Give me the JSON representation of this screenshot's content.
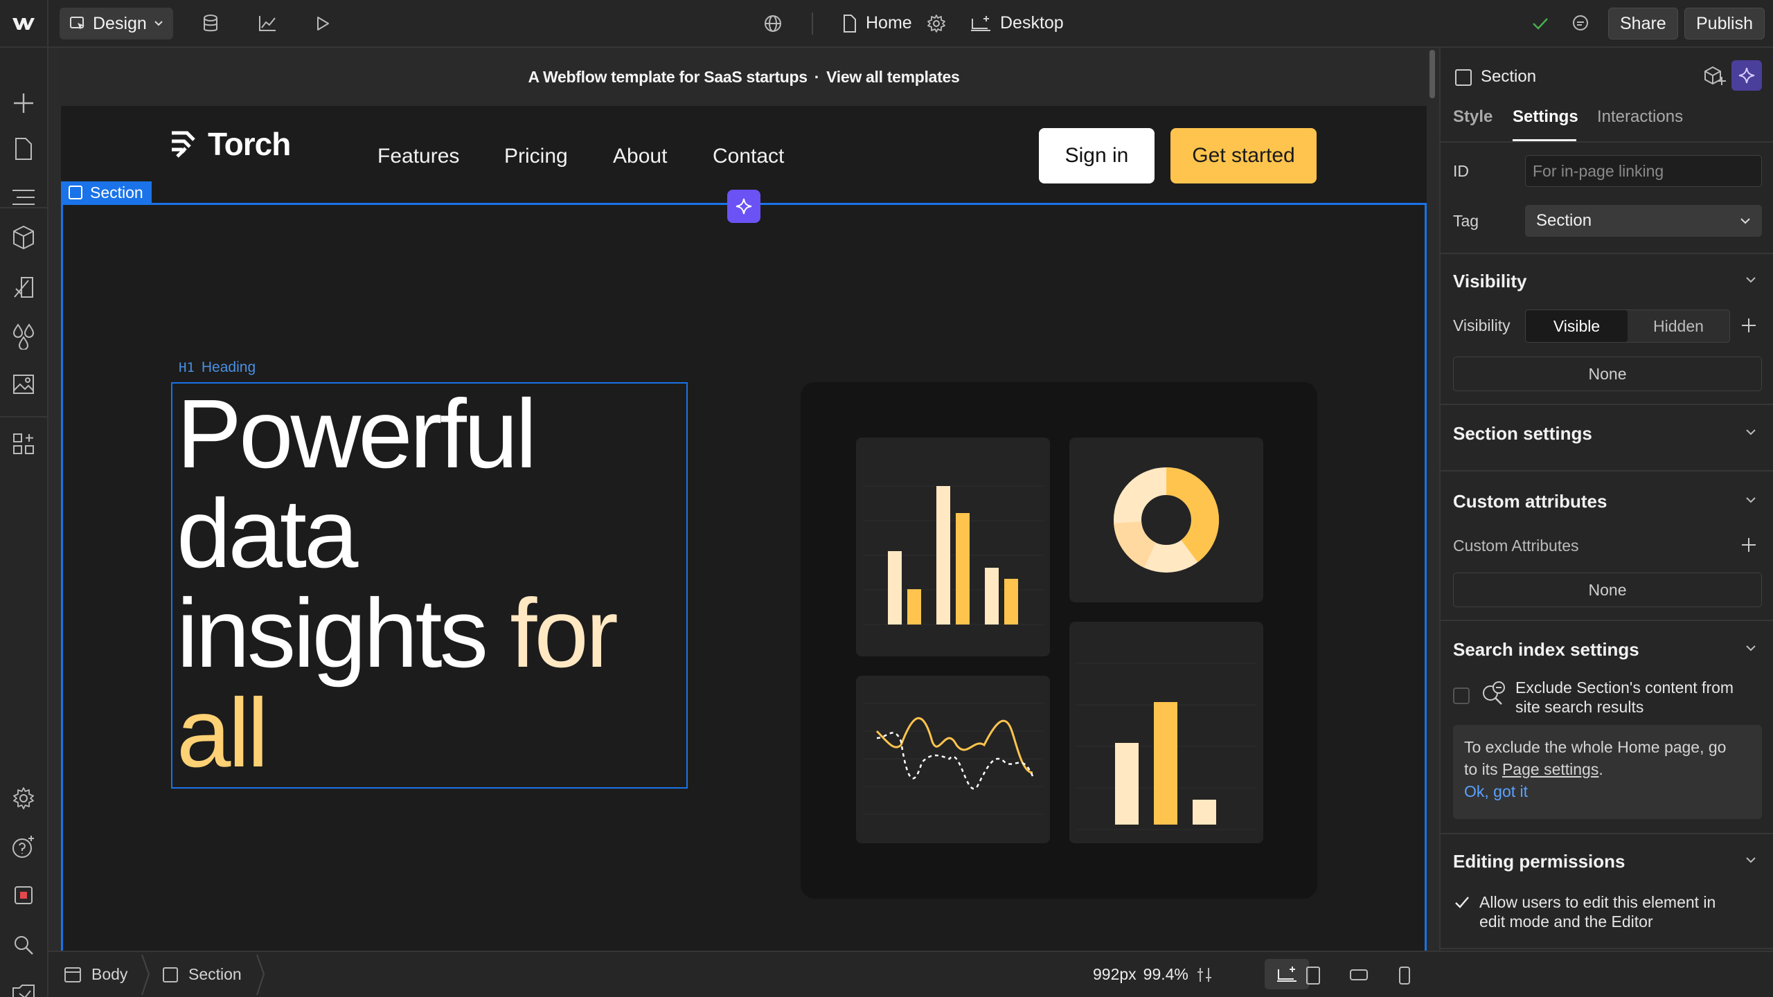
{
  "toolbar": {
    "mode_label": "Design",
    "page_name": "Home",
    "breakpoint_label": "Desktop",
    "share_label": "Share",
    "publish_label": "Publish"
  },
  "canvas": {
    "banner_text": "A Webflow template for SaaS startups",
    "banner_sep": "·",
    "banner_link": "View all templates",
    "brand_name": "Torch",
    "nav_links": [
      "Features",
      "Pricing",
      "About",
      "Contact"
    ],
    "signin_label": "Sign in",
    "cta_label": "Get started",
    "section_tag": "Section",
    "h1_tag_code": "H1",
    "h1_tag_label": "Heading",
    "heading_line1": "Powerful",
    "heading_line2": "data",
    "heading_line3a": "insights",
    "heading_line3b": "for",
    "heading_line4": "all"
  },
  "panel": {
    "element_name": "Section",
    "tabs": [
      "Style",
      "Settings",
      "Interactions"
    ],
    "active_tab": "Settings",
    "id_label": "ID",
    "id_placeholder": "For in-page linking",
    "tag_label": "Tag",
    "tag_value": "Section",
    "visibility_heading": "Visibility",
    "visibility_label": "Visibility",
    "visible_option": "Visible",
    "hidden_option": "Hidden",
    "visibility_none": "None",
    "section_settings_heading": "Section settings",
    "custom_attributes_heading": "Custom attributes",
    "custom_attributes_label": "Custom Attributes",
    "custom_attributes_none": "None",
    "search_index_heading": "Search index settings",
    "exclude_text_line1": "Exclude Section's content from",
    "exclude_text_line2": "site search results",
    "tip_line1": "To exclude the whole Home page, go",
    "tip_to": "to its",
    "tip_link": "Page settings",
    "tip_period": ".",
    "tip_ok": "Ok, got it",
    "editing_heading": "Editing permissions",
    "allow_line1": "Allow users to edit this element in",
    "allow_line2": "edit mode and the Editor"
  },
  "bottom": {
    "crumbs": [
      "Body",
      "Section"
    ],
    "width_label": "992px",
    "zoom_label": "99.4%"
  },
  "colors": {
    "accent_blue": "#1a73e8",
    "ai_purple": "#6b52f5",
    "cta_yellow": "#ffc44d",
    "success_green": "#4caf50"
  }
}
